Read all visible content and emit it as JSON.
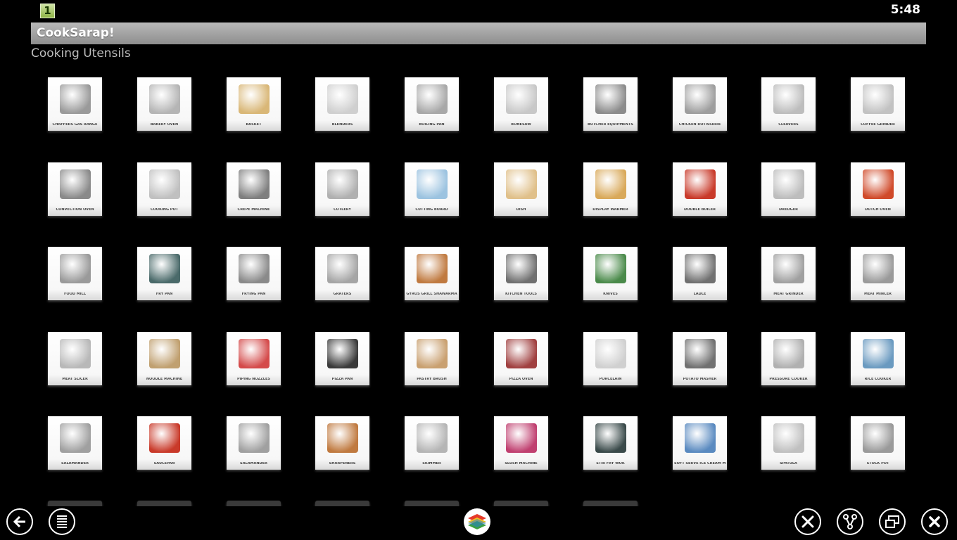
{
  "statusbar": {
    "notification_icon_text": "1",
    "clock": "5:48"
  },
  "app": {
    "title": "CookSarap!",
    "section_title": "Cooking Utensils"
  },
  "tiles": [
    {
      "label": "CHAFFERS GAS RANGE",
      "color": "#9a9a9a"
    },
    {
      "label": "BAKERY OVEN",
      "color": "#b5b5b5"
    },
    {
      "label": "BASKET",
      "color": "#d9b777"
    },
    {
      "label": "BLENDERS",
      "color": "#cfcfcf"
    },
    {
      "label": "BOILING PAN",
      "color": "#a8a8a8"
    },
    {
      "label": "BONESAW",
      "color": "#c8c8c8"
    },
    {
      "label": "BUTCHER EQUIPMENTS",
      "color": "#8c8c8c"
    },
    {
      "label": "CHICKEN ROTISSERIE",
      "color": "#9e9e9e"
    },
    {
      "label": "CLEAVERS",
      "color": "#bdbdbd"
    },
    {
      "label": "COFFEE GRINDER",
      "color": "#c2c2c2"
    },
    {
      "label": "CONVECTION OVEN",
      "color": "#8a8a8a"
    },
    {
      "label": "COOKING POT",
      "color": "#c0c0c0"
    },
    {
      "label": "CREPE MACHINE",
      "color": "#7f7f7f"
    },
    {
      "label": "CUTLERY",
      "color": "#b0b0b0"
    },
    {
      "label": "CUTTING BOARD",
      "color": "#9cc3e0"
    },
    {
      "label": "DISH",
      "color": "#e0c08a"
    },
    {
      "label": "DISPLAY WARMER",
      "color": "#d9a95a"
    },
    {
      "label": "DOUBLE BOILER",
      "color": "#c93a2a"
    },
    {
      "label": "DREDGER",
      "color": "#bdbdbd"
    },
    {
      "label": "DUTCH OVEN",
      "color": "#d04a2a"
    },
    {
      "label": "FOOD MILL",
      "color": "#9a9a9a"
    },
    {
      "label": "FRY PAN",
      "color": "#4a6a6a"
    },
    {
      "label": "FRYING PAN",
      "color": "#8a8a8a"
    },
    {
      "label": "GRATERS",
      "color": "#a5a5a5"
    },
    {
      "label": "GYROS GRILL SHAWARMA",
      "color": "#c07a40"
    },
    {
      "label": "KITCHEN TOOLS",
      "color": "#707070"
    },
    {
      "label": "KNIVES",
      "color": "#4a8a4a"
    },
    {
      "label": "LADLE",
      "color": "#707070"
    },
    {
      "label": "MEAT GRINDER",
      "color": "#a0a0a0"
    },
    {
      "label": "MEAT MINCER",
      "color": "#9a9a9a"
    },
    {
      "label": "MEAT SLICER",
      "color": "#b8b8b8"
    },
    {
      "label": "NOODLE MACHINE",
      "color": "#c0a070"
    },
    {
      "label": "PIPING NOZZLES",
      "color": "#d44a4a"
    },
    {
      "label": "PIZZA PAN",
      "color": "#3a3a3a"
    },
    {
      "label": "PASTRY BRUSH",
      "color": "#c9a070"
    },
    {
      "label": "PIZZA OVEN",
      "color": "#a04040"
    },
    {
      "label": "PORCELAIN",
      "color": "#d0d0d0"
    },
    {
      "label": "POTATO MASHER",
      "color": "#707070"
    },
    {
      "label": "PRESSURE COOKER",
      "color": "#b0b0b0"
    },
    {
      "label": "RICE COOKER",
      "color": "#6a9ac0"
    },
    {
      "label": "SALAMANDER",
      "color": "#a0a0a0"
    },
    {
      "label": "SAUCEPAN",
      "color": "#c93a2a"
    },
    {
      "label": "SALAMANDER",
      "color": "#a0a0a0"
    },
    {
      "label": "SHARPENERS",
      "color": "#c07a40"
    },
    {
      "label": "SKIMMER",
      "color": "#b5b5b5"
    },
    {
      "label": "SLUSH MACHINE",
      "color": "#c04070"
    },
    {
      "label": "STIR FRY WOK",
      "color": "#3a4a4a"
    },
    {
      "label": "SOFT SERVE ICE CREAM MACHINE",
      "color": "#5a8ac0"
    },
    {
      "label": "SPATULA",
      "color": "#c0c0c0"
    },
    {
      "label": "STOCK POT",
      "color": "#9a9a9a"
    }
  ],
  "partial_tiles_count_note": "",
  "navbar": {
    "back": "back-arrow-icon",
    "menu": "list-menu-icon",
    "launcher": "bluestacks-logo-icon",
    "settings": "tools-icon",
    "share": "share-icon",
    "window": "window-toggle-icon",
    "close": "close-icon"
  }
}
